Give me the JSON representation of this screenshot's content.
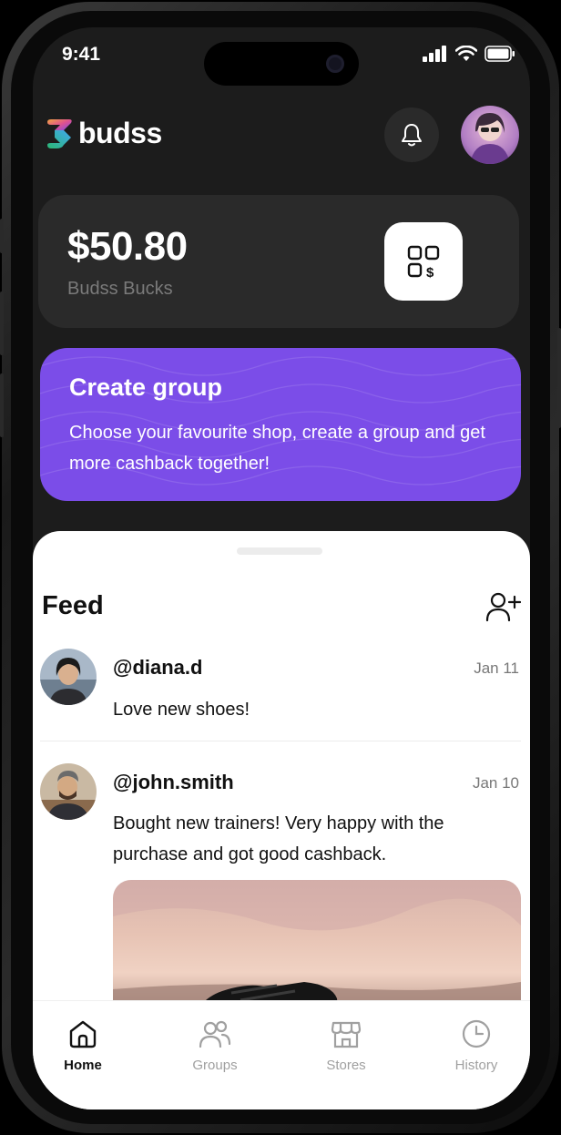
{
  "status_bar": {
    "time": "9:41"
  },
  "header": {
    "app_name": "budss",
    "bell_icon": "bell-icon",
    "avatar": "profile-avatar"
  },
  "balance": {
    "amount": "$50.80",
    "label": "Budss Bucks",
    "qr_icon": "qr-wallet-icon"
  },
  "promo": {
    "title": "Create group",
    "body": "Choose your favourite shop, create a group and get more cashback together!",
    "color": "#7b4de8"
  },
  "feed": {
    "title": "Feed",
    "add_icon": "add-friend-icon",
    "posts": [
      {
        "user": "@diana.d",
        "date": "Jan 11",
        "text": "Love new shoes!"
      },
      {
        "user": "@john.smith",
        "date": "Jan 10",
        "text": "Bought new trainers! Very happy with the purchase and got good cashback."
      }
    ]
  },
  "tabs": [
    {
      "label": "Home",
      "icon": "home-icon",
      "active": true
    },
    {
      "label": "Groups",
      "icon": "groups-icon",
      "active": false
    },
    {
      "label": "Stores",
      "icon": "store-icon",
      "active": false
    },
    {
      "label": "History",
      "icon": "clock-icon",
      "active": false
    }
  ]
}
